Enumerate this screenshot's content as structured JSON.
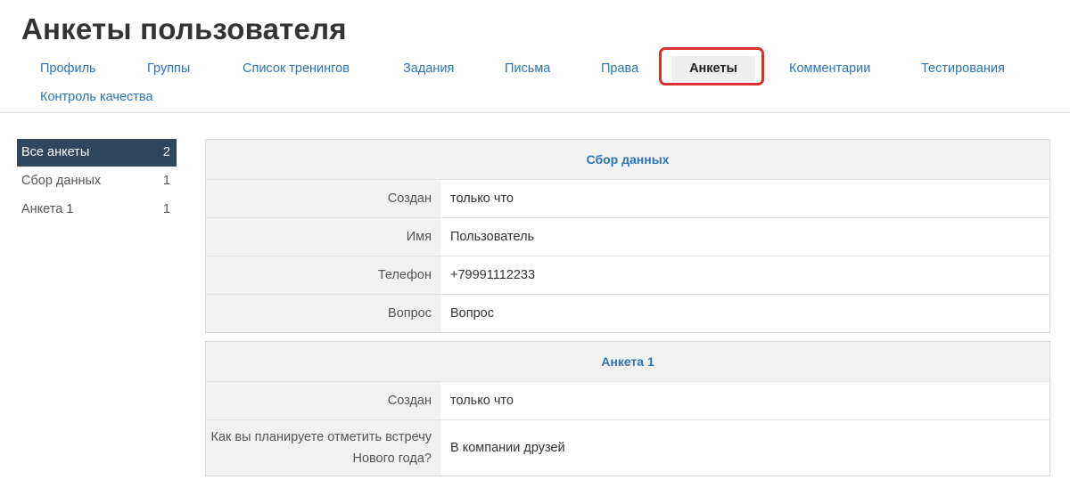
{
  "page": {
    "title": "Анкеты пользователя"
  },
  "tabs": [
    {
      "label": "Профиль"
    },
    {
      "label": "Группы"
    },
    {
      "label": "Список тренингов"
    },
    {
      "label": "Задания"
    },
    {
      "label": "Письма"
    },
    {
      "label": "Права"
    },
    {
      "label": "Анкеты",
      "active": true
    },
    {
      "label": "Комментарии"
    },
    {
      "label": "Тестирования"
    },
    {
      "label": "Контроль качества"
    }
  ],
  "sidebar": {
    "items": [
      {
        "label": "Все анкеты",
        "count": "2",
        "active": true
      },
      {
        "label": "Сбор данных",
        "count": "1"
      },
      {
        "label": "Анкета 1",
        "count": "1"
      }
    ]
  },
  "cards": [
    {
      "title": "Сбор данных",
      "rows": [
        {
          "key": "Создан",
          "value": "только что"
        },
        {
          "key": "Имя",
          "value": "Пользователь"
        },
        {
          "key": "Телефон",
          "value": "+79991112233"
        },
        {
          "key": "Вопрос",
          "value": "Вопрос"
        }
      ]
    },
    {
      "title": "Анкета 1",
      "rows": [
        {
          "key": "Создан",
          "value": "только что"
        },
        {
          "key": "Как вы планируете отметить встречу Нового года?",
          "value": "В компании друзей"
        }
      ]
    }
  ],
  "colors": {
    "link": "#2a74ba",
    "sidebar_active": "#2f475e",
    "highlight": "#d9322c"
  }
}
